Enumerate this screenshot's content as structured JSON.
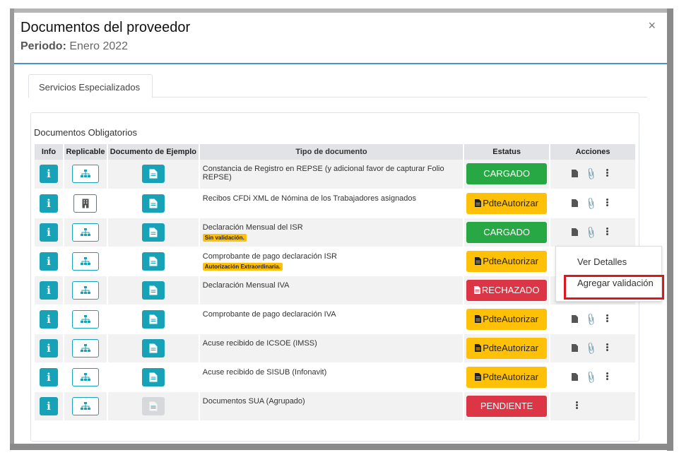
{
  "modal": {
    "title": "Documentos del proveedor",
    "period_label": "Periodo:",
    "period_value": "Enero 2022",
    "close": "×"
  },
  "tabs": [
    {
      "label": "Servicios Especializados"
    }
  ],
  "card": {
    "title": "Documentos Obligatorios",
    "columns": [
      "Info",
      "Replicable",
      "Documento de Ejemplo",
      "Tipo de documento",
      "Estatus",
      "Acciones"
    ],
    "rows": [
      {
        "tipo": "Constancia de Registro en REPSE (y adicional favor de capturar Folio REPSE)",
        "badge": "",
        "estatus": "CARGADO",
        "status_kind": "ok",
        "replicable_icon": "sitemap-icon",
        "doc_disabled": false
      },
      {
        "tipo": "Recibos CFDi XML de Nómina de los Trabajadores asignados",
        "badge": "",
        "estatus": "PdteAutorizar",
        "status_kind": "pend",
        "replicable_icon": "building-icon",
        "doc_disabled": false
      },
      {
        "tipo": "Declaración Mensual del ISR",
        "badge": "Sin validación.",
        "estatus": "CARGADO",
        "status_kind": "ok",
        "replicable_icon": "sitemap-icon",
        "doc_disabled": false
      },
      {
        "tipo": "Comprobante de pago declaración ISR",
        "badge": "Autorización Extraordinaria.",
        "estatus": "PdteAutorizar",
        "status_kind": "pend",
        "replicable_icon": "sitemap-icon",
        "doc_disabled": false
      },
      {
        "tipo": "Declaración Mensual IVA",
        "badge": "",
        "estatus": "RECHAZADO",
        "status_kind": "rej",
        "replicable_icon": "sitemap-icon",
        "doc_disabled": false
      },
      {
        "tipo": "Comprobante de pago declaración IVA",
        "badge": "",
        "estatus": "PdteAutorizar",
        "status_kind": "pend",
        "replicable_icon": "sitemap-icon",
        "doc_disabled": false
      },
      {
        "tipo": "Acuse recibido de ICSOE (IMSS)",
        "badge": "",
        "estatus": "PdteAutorizar",
        "status_kind": "pend",
        "replicable_icon": "sitemap-icon",
        "doc_disabled": false
      },
      {
        "tipo": "Acuse recibido de SISUB (Infonavit)",
        "badge": "",
        "estatus": "PdteAutorizar",
        "status_kind": "pend",
        "replicable_icon": "sitemap-icon",
        "doc_disabled": false
      },
      {
        "tipo": "Documentos SUA (Agrupado)",
        "badge": "",
        "estatus": "PENDIENTE",
        "status_kind": "rej",
        "replicable_icon": "sitemap-icon",
        "doc_disabled": true
      }
    ]
  },
  "dropdown": {
    "items": [
      "Ver Detalles",
      "Agregar validación"
    ]
  },
  "colors": {
    "info": "#17a2b8",
    "success": "#28a745",
    "warning": "#ffc107",
    "danger": "#dc3545",
    "highlight": "#e0161c"
  }
}
